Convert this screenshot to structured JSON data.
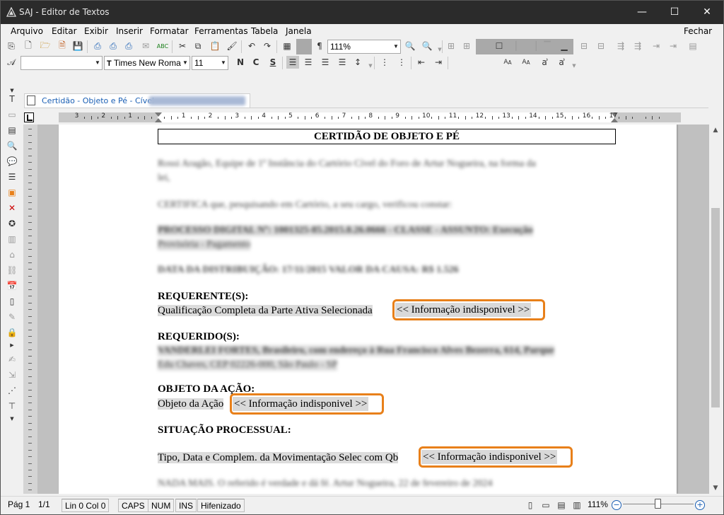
{
  "window": {
    "title": "SAJ - Editor de Textos",
    "minimize_glyph": "—",
    "maximize_glyph": "☐",
    "close_glyph": "✕"
  },
  "menu": {
    "items": [
      {
        "label": "Arquivo"
      },
      {
        "label": "Editar"
      },
      {
        "label": "Exibir"
      },
      {
        "label": "Inserir"
      },
      {
        "label": "Formatar"
      },
      {
        "label": "Ferramentas"
      },
      {
        "label": "Tabela"
      },
      {
        "label": "Janela"
      }
    ],
    "close_label": "Fechar"
  },
  "toolbar": {
    "zoom_value": "111%",
    "pilcrow": "¶",
    "style_value": "",
    "font_name": "Times New Romar",
    "font_size": "11",
    "bold": "N",
    "italic": "C",
    "underline": "S",
    "superscript_a": "A",
    "subscript_a": "A"
  },
  "tab": {
    "label": "Certidão - Objeto e Pé - Cível"
  },
  "ruler": {
    "numbers": [
      "3",
      "2",
      "1",
      "1",
      "2",
      "3",
      "4",
      "5",
      "6",
      "7",
      "8",
      "9",
      "10",
      "11",
      "12",
      "13",
      "14",
      "15",
      "16",
      "17"
    ]
  },
  "document": {
    "title": "CERTIDÃO DE OBJETO E PÉ",
    "blurred": {
      "line1": "Rossi Aragão, Equipe de 1ª Instância do Cartório Cível do Foro de Artur Nogueira, na forma da",
      "line2": "lei,",
      "line3": "CERTIFICA que, pesquisando em Cartório, a seu cargo, verificou constar:",
      "line4": "PROCESSO DIGITAL Nº: 1001325-85.2015.8.26.0666 - CLASSE - ASSUNTO: Execução",
      "line5": "Provisória - Pagamento",
      "line6": "DATA DA DISTRIBUIÇÃO: 17/11/2015  VALOR DA CAUSA: R$ 1.526",
      "line7": "VANDERLEI FORTES, Brasileiro, com endereço à Rua Francisco Alves Bezerra, 614, Parque",
      "line8": "Edu Chaves, CEP 02226-000, São Paulo - SP",
      "line9": "NADA MAIS. O referido é verdade e dá fé. Artur Nogueira, 22 de fevereiro de 2024"
    },
    "requerente_label": "REQUERENTE(S):",
    "requerente_field": "Qualificação Completa da Parte Ativa Selecionada",
    "requerido_label": "REQUERIDO(S):",
    "objeto_label": "OBJETO DA AÇÃO:",
    "objeto_field": "Objeto da Ação",
    "situacao_label": "SITUAÇÃO PROCESSUAL:",
    "situacao_field": "Tipo, Data e Complem. da Movimentação Selec com Qb",
    "placeholder": "<< Informação indisponivel >>",
    "highlight_color": "#e8801a"
  },
  "status": {
    "page": "Pág 1",
    "pages": "1/1",
    "position": "Lin 0  Col 0",
    "caps": "CAPS",
    "num": "NUM",
    "ins": "INS",
    "hyphen": "Hifenizado",
    "zoom": "111%",
    "zoom_out": "−",
    "zoom_in": "+"
  }
}
